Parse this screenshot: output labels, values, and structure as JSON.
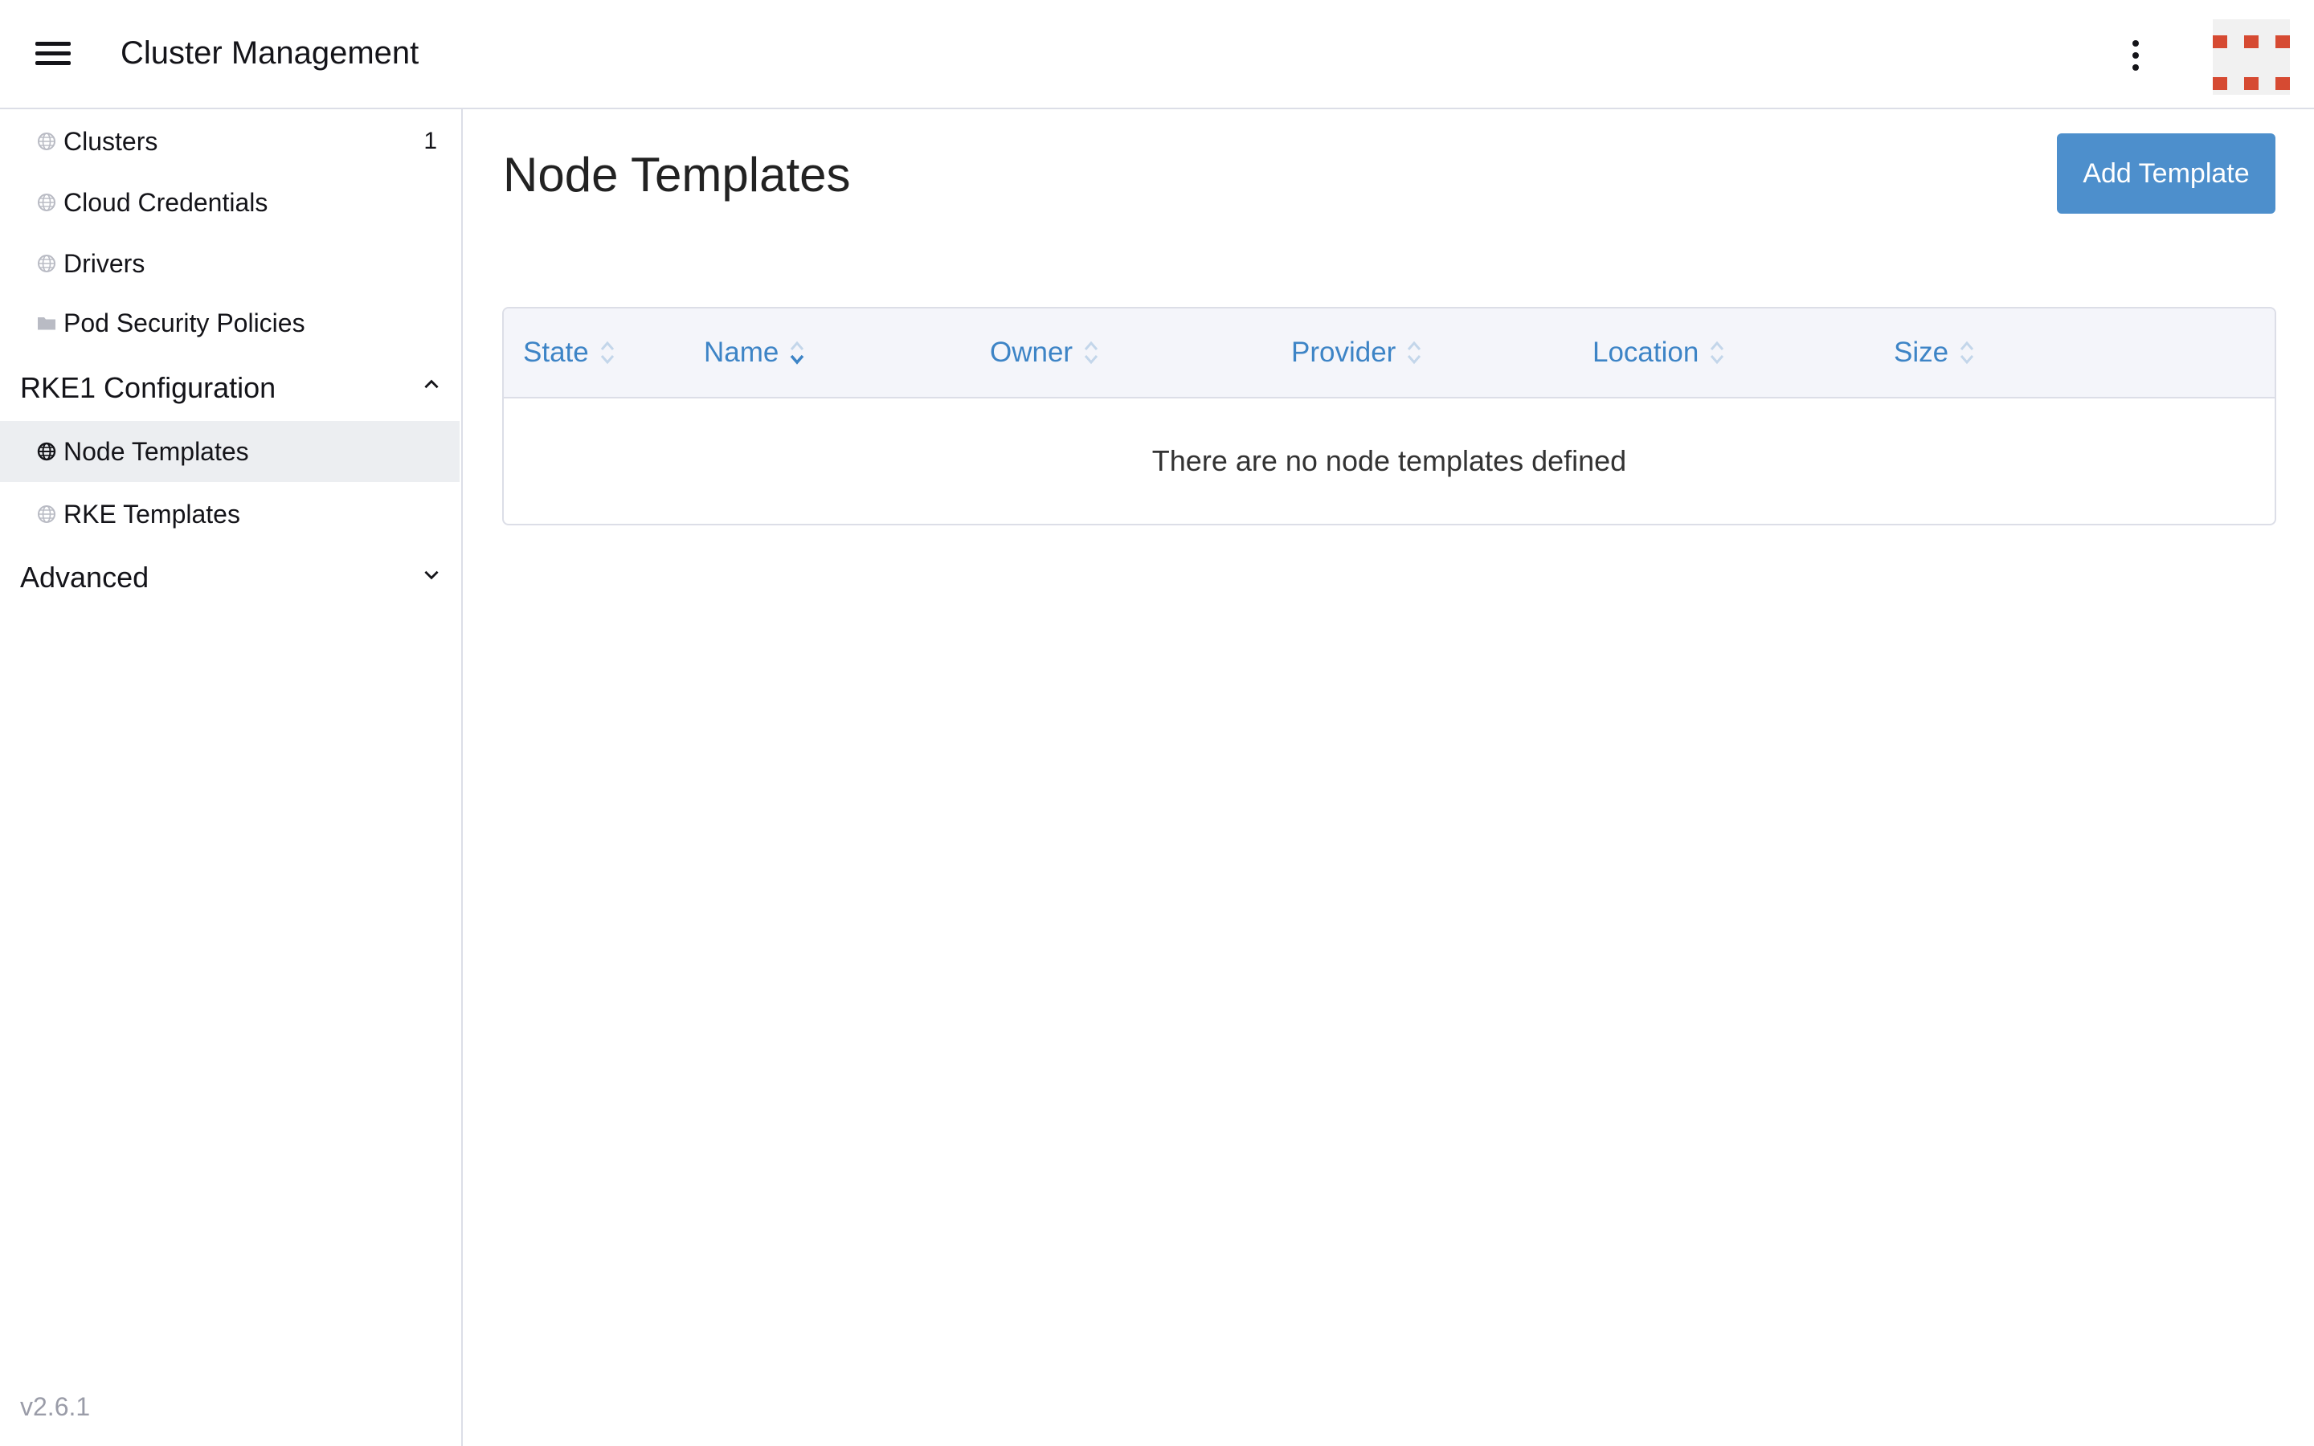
{
  "header": {
    "title": "Cluster Management",
    "menu_icon": "hamburger-menu-icon",
    "more_icon": "vertical-ellipsis-icon",
    "brand_color": "#d64a32"
  },
  "sidebar": {
    "items": [
      {
        "label": "Clusters",
        "count": "1",
        "icon": "globe-icon"
      },
      {
        "label": "Cloud Credentials",
        "icon": "globe-icon"
      },
      {
        "label": "Drivers",
        "icon": "globe-icon"
      },
      {
        "label": "Pod Security Policies",
        "icon": "folder-icon"
      }
    ],
    "groups": [
      {
        "label": "RKE1 Configuration",
        "expanded": true,
        "items": [
          {
            "label": "Node Templates",
            "icon": "globe-icon",
            "active": true
          },
          {
            "label": "RKE Templates",
            "icon": "globe-icon"
          }
        ]
      },
      {
        "label": "Advanced",
        "expanded": false
      }
    ],
    "version": "v2.6.1"
  },
  "main": {
    "title": "Node Templates",
    "add_button": "Add Template",
    "accent_color": "#4d8fcc",
    "table": {
      "columns": [
        "State",
        "Name",
        "Owner",
        "Provider",
        "Location",
        "Size"
      ],
      "sorted_column": "Name",
      "empty_message": "There are no node templates defined"
    }
  }
}
